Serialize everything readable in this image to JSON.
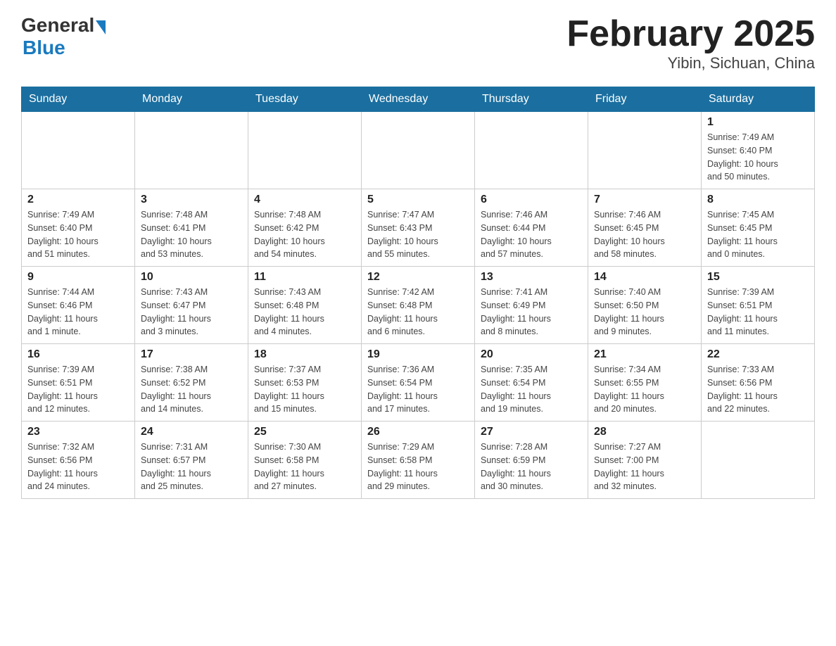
{
  "header": {
    "logo_general": "General",
    "logo_blue": "Blue",
    "title": "February 2025",
    "subtitle": "Yibin, Sichuan, China"
  },
  "days_of_week": [
    "Sunday",
    "Monday",
    "Tuesday",
    "Wednesday",
    "Thursday",
    "Friday",
    "Saturday"
  ],
  "weeks": [
    [
      {
        "day": "",
        "info": ""
      },
      {
        "day": "",
        "info": ""
      },
      {
        "day": "",
        "info": ""
      },
      {
        "day": "",
        "info": ""
      },
      {
        "day": "",
        "info": ""
      },
      {
        "day": "",
        "info": ""
      },
      {
        "day": "1",
        "info": "Sunrise: 7:49 AM\nSunset: 6:40 PM\nDaylight: 10 hours\nand 50 minutes."
      }
    ],
    [
      {
        "day": "2",
        "info": "Sunrise: 7:49 AM\nSunset: 6:40 PM\nDaylight: 10 hours\nand 51 minutes."
      },
      {
        "day": "3",
        "info": "Sunrise: 7:48 AM\nSunset: 6:41 PM\nDaylight: 10 hours\nand 53 minutes."
      },
      {
        "day": "4",
        "info": "Sunrise: 7:48 AM\nSunset: 6:42 PM\nDaylight: 10 hours\nand 54 minutes."
      },
      {
        "day": "5",
        "info": "Sunrise: 7:47 AM\nSunset: 6:43 PM\nDaylight: 10 hours\nand 55 minutes."
      },
      {
        "day": "6",
        "info": "Sunrise: 7:46 AM\nSunset: 6:44 PM\nDaylight: 10 hours\nand 57 minutes."
      },
      {
        "day": "7",
        "info": "Sunrise: 7:46 AM\nSunset: 6:45 PM\nDaylight: 10 hours\nand 58 minutes."
      },
      {
        "day": "8",
        "info": "Sunrise: 7:45 AM\nSunset: 6:45 PM\nDaylight: 11 hours\nand 0 minutes."
      }
    ],
    [
      {
        "day": "9",
        "info": "Sunrise: 7:44 AM\nSunset: 6:46 PM\nDaylight: 11 hours\nand 1 minute."
      },
      {
        "day": "10",
        "info": "Sunrise: 7:43 AM\nSunset: 6:47 PM\nDaylight: 11 hours\nand 3 minutes."
      },
      {
        "day": "11",
        "info": "Sunrise: 7:43 AM\nSunset: 6:48 PM\nDaylight: 11 hours\nand 4 minutes."
      },
      {
        "day": "12",
        "info": "Sunrise: 7:42 AM\nSunset: 6:48 PM\nDaylight: 11 hours\nand 6 minutes."
      },
      {
        "day": "13",
        "info": "Sunrise: 7:41 AM\nSunset: 6:49 PM\nDaylight: 11 hours\nand 8 minutes."
      },
      {
        "day": "14",
        "info": "Sunrise: 7:40 AM\nSunset: 6:50 PM\nDaylight: 11 hours\nand 9 minutes."
      },
      {
        "day": "15",
        "info": "Sunrise: 7:39 AM\nSunset: 6:51 PM\nDaylight: 11 hours\nand 11 minutes."
      }
    ],
    [
      {
        "day": "16",
        "info": "Sunrise: 7:39 AM\nSunset: 6:51 PM\nDaylight: 11 hours\nand 12 minutes."
      },
      {
        "day": "17",
        "info": "Sunrise: 7:38 AM\nSunset: 6:52 PM\nDaylight: 11 hours\nand 14 minutes."
      },
      {
        "day": "18",
        "info": "Sunrise: 7:37 AM\nSunset: 6:53 PM\nDaylight: 11 hours\nand 15 minutes."
      },
      {
        "day": "19",
        "info": "Sunrise: 7:36 AM\nSunset: 6:54 PM\nDaylight: 11 hours\nand 17 minutes."
      },
      {
        "day": "20",
        "info": "Sunrise: 7:35 AM\nSunset: 6:54 PM\nDaylight: 11 hours\nand 19 minutes."
      },
      {
        "day": "21",
        "info": "Sunrise: 7:34 AM\nSunset: 6:55 PM\nDaylight: 11 hours\nand 20 minutes."
      },
      {
        "day": "22",
        "info": "Sunrise: 7:33 AM\nSunset: 6:56 PM\nDaylight: 11 hours\nand 22 minutes."
      }
    ],
    [
      {
        "day": "23",
        "info": "Sunrise: 7:32 AM\nSunset: 6:56 PM\nDaylight: 11 hours\nand 24 minutes."
      },
      {
        "day": "24",
        "info": "Sunrise: 7:31 AM\nSunset: 6:57 PM\nDaylight: 11 hours\nand 25 minutes."
      },
      {
        "day": "25",
        "info": "Sunrise: 7:30 AM\nSunset: 6:58 PM\nDaylight: 11 hours\nand 27 minutes."
      },
      {
        "day": "26",
        "info": "Sunrise: 7:29 AM\nSunset: 6:58 PM\nDaylight: 11 hours\nand 29 minutes."
      },
      {
        "day": "27",
        "info": "Sunrise: 7:28 AM\nSunset: 6:59 PM\nDaylight: 11 hours\nand 30 minutes."
      },
      {
        "day": "28",
        "info": "Sunrise: 7:27 AM\nSunset: 7:00 PM\nDaylight: 11 hours\nand 32 minutes."
      },
      {
        "day": "",
        "info": ""
      }
    ]
  ]
}
